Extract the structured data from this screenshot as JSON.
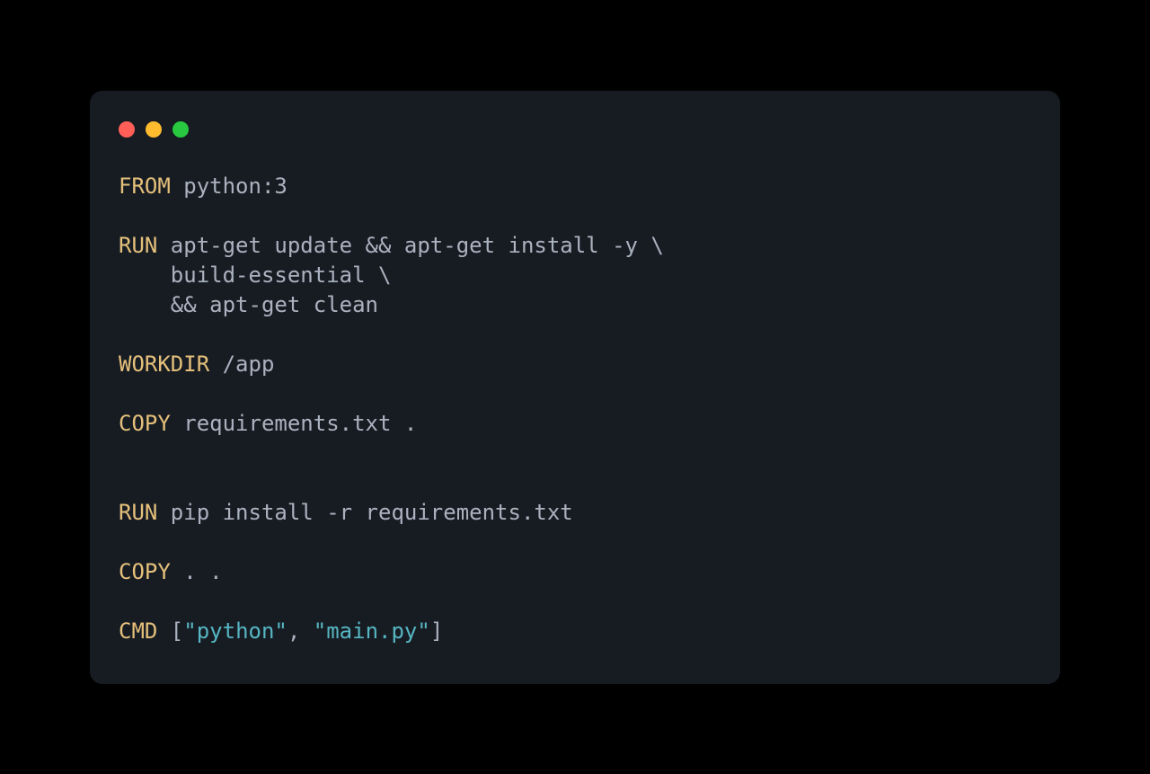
{
  "code": {
    "lines": [
      {
        "segments": [
          {
            "class": "kw",
            "text": "FROM"
          },
          {
            "class": "txt",
            "text": " python:3"
          }
        ]
      },
      {
        "segments": [
          {
            "class": "txt",
            "text": ""
          }
        ]
      },
      {
        "segments": [
          {
            "class": "kw",
            "text": "RUN"
          },
          {
            "class": "txt",
            "text": " apt-get update && apt-get install -y \\"
          }
        ]
      },
      {
        "segments": [
          {
            "class": "txt",
            "text": "    build-essential \\"
          }
        ]
      },
      {
        "segments": [
          {
            "class": "txt",
            "text": "    && apt-get clean"
          }
        ]
      },
      {
        "segments": [
          {
            "class": "txt",
            "text": ""
          }
        ]
      },
      {
        "segments": [
          {
            "class": "kw",
            "text": "WORKDIR"
          },
          {
            "class": "txt",
            "text": " /app"
          }
        ]
      },
      {
        "segments": [
          {
            "class": "txt",
            "text": ""
          }
        ]
      },
      {
        "segments": [
          {
            "class": "kw",
            "text": "COPY"
          },
          {
            "class": "txt",
            "text": " requirements.txt ."
          }
        ]
      },
      {
        "segments": [
          {
            "class": "txt",
            "text": ""
          }
        ]
      },
      {
        "segments": [
          {
            "class": "txt",
            "text": ""
          }
        ]
      },
      {
        "segments": [
          {
            "class": "kw",
            "text": "RUN"
          },
          {
            "class": "txt",
            "text": " pip install -r requirements.txt"
          }
        ]
      },
      {
        "segments": [
          {
            "class": "txt",
            "text": ""
          }
        ]
      },
      {
        "segments": [
          {
            "class": "kw",
            "text": "COPY"
          },
          {
            "class": "txt",
            "text": " . ."
          }
        ]
      },
      {
        "segments": [
          {
            "class": "txt",
            "text": ""
          }
        ]
      },
      {
        "segments": [
          {
            "class": "kw",
            "text": "CMD"
          },
          {
            "class": "txt",
            "text": " ["
          },
          {
            "class": "str",
            "text": "\"python\""
          },
          {
            "class": "txt",
            "text": ", "
          },
          {
            "class": "str",
            "text": "\"main.py\""
          },
          {
            "class": "txt",
            "text": "]"
          }
        ]
      }
    ]
  }
}
